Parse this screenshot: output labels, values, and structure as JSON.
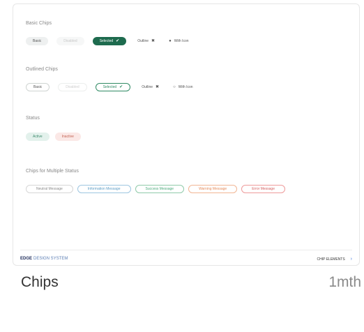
{
  "card": {
    "basic_title": "Basic Chips",
    "basic_chips": [
      "Basic",
      "Disabled",
      "Selected",
      "Outline",
      "With Icon"
    ],
    "outlined_title": "Outlined Chips",
    "outlined_chips": [
      "Basic",
      "Disabled",
      "Selected",
      "Outline",
      "With Icon"
    ],
    "status_title": "Status",
    "status_chips": [
      "Active",
      "Inactive"
    ],
    "multi_title": "Chips for Multiple Status",
    "multi_chips": [
      "Neutral Message",
      "Information Message",
      "Success Message",
      "Warning Message",
      "Error Message"
    ],
    "footer_brand_bold": "EDGE",
    "footer_brand_light": "DESIGN SYSTEM",
    "footer_right": "CHIP ELEMENTS",
    "footer_arrow": "›"
  },
  "caption": {
    "title": "Chips",
    "meta": "1mth"
  },
  "icons": {
    "check": "check-icon",
    "close": "close-circle-icon",
    "user": "user-icon"
  }
}
